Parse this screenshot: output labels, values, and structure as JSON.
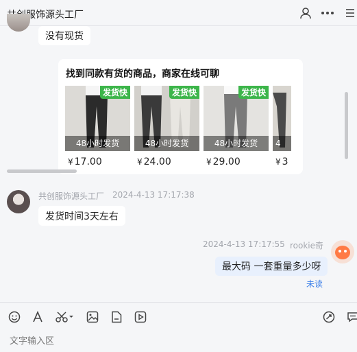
{
  "header": {
    "title": "共创服饰源头工厂",
    "icons": [
      "person-icon",
      "more-icon",
      "list-icon"
    ]
  },
  "messages": {
    "m1": {
      "text": "没有现货"
    },
    "card": {
      "title": "找到同款有货的商品，商家在线可聊",
      "products": [
        {
          "badge": "发货快",
          "tag": "48小时发货",
          "currency": "¥",
          "price": "17.00",
          "pants_color": "#2b2b2b",
          "bg": "#dcdad6"
        },
        {
          "badge": "发货快",
          "tag": "48小时发货",
          "currency": "¥",
          "price": "24.00",
          "pants_color": "#3a3a3a",
          "bg": "#d2d0cb"
        },
        {
          "badge": "发货快",
          "tag": "48小时发货",
          "currency": "¥",
          "price": "29.00",
          "pants_color": "#7a7a7a",
          "bg": "#e4e3e0"
        },
        {
          "badge": "",
          "tag": "4",
          "currency": "¥",
          "price": "3",
          "pants_color": "#4a4a4a",
          "bg": "#d8d5cf"
        }
      ]
    },
    "m2": {
      "sender": "共创服饰源头工厂",
      "time": "2024-4-13 17:17:38",
      "text": "发货时间3天左右"
    },
    "m3": {
      "time": "2024-4-13 17:17:55",
      "sender": "rookie奇",
      "text": "最大码 一套重量多少呀",
      "status": "未读"
    }
  },
  "composer": {
    "tools_left": [
      "emoji-icon",
      "font-icon",
      "scissors-icon",
      "image-icon",
      "file-icon",
      "video-icon"
    ],
    "tools_right": [
      "send-card-icon",
      "quick-reply-icon"
    ],
    "placeholder": "文字输入区"
  }
}
